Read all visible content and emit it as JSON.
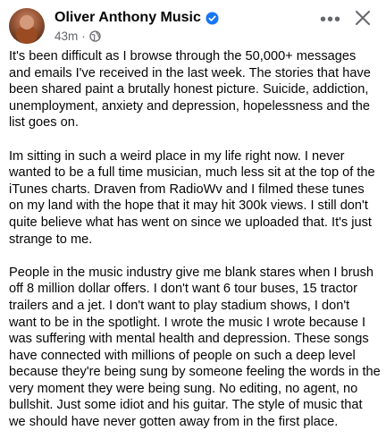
{
  "post": {
    "author": "Oliver Anthony Music",
    "verified_icon": "verified-badge-icon",
    "time": "43m",
    "separator": "·",
    "audience_icon": "globe-icon",
    "more_label": "•••",
    "close_icon": "close-icon",
    "paragraphs": [
      "It's been difficult as I browse through the 50,000+ messages and emails I've received in the last week. The stories that have been shared paint a brutally honest picture. Suicide, addiction, unemployment, anxiety and depression, hopelessness and the list goes on.",
      "Im sitting in such a weird place in my life right now. I never wanted to be a full time musician, much less sit at the top of the iTunes charts. Draven from RadioWv and I filmed these tunes on my land with the hope that it may hit 300k views. I still don't quite believe what has went on since we uploaded that. It's just strange to me.",
      "People in the music industry give me blank stares when I brush off 8 million dollar offers. I don't want 6 tour buses, 15 tractor trailers and a jet. I don't want to play stadium shows, I don't want to be in the spotlight. I wrote the music I wrote because I was suffering with mental health and depression. These songs have connected with millions of people on such a deep level because they're being sung by someone feeling the words in the very moment they were being sung. No editing, no agent, no bullshit. Just some idiot and his guitar. The style of music that we should have never gotten away from in the first place."
    ]
  },
  "colors": {
    "verified": "#1877f2",
    "secondary_text": "#65676b",
    "primary_text": "#050505"
  }
}
